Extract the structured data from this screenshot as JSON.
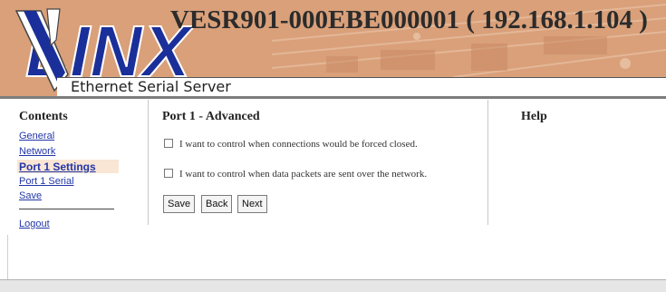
{
  "header": {
    "device_title": "VESR901-000EBE000001 ( 192.168.1.104 )",
    "brand": "VLINX",
    "tagline": "Ethernet Serial Server"
  },
  "sidebar": {
    "title": "Contents",
    "items": [
      {
        "label": "General"
      },
      {
        "label": "Network"
      },
      {
        "label": "Port 1 Settings"
      },
      {
        "label": "Port 1 Serial"
      },
      {
        "label": "Save"
      }
    ],
    "logout": "Logout"
  },
  "main": {
    "title": "Port 1 - Advanced",
    "options": [
      {
        "label": "I want to control when connections would be forced closed.",
        "checked": false
      },
      {
        "label": "I want to control when data packets are sent over the network.",
        "checked": false
      }
    ],
    "buttons": {
      "save": "Save",
      "back": "Back",
      "next": "Next"
    }
  },
  "help": {
    "title": "Help"
  },
  "colors": {
    "header_bg": "#d9a07a",
    "logo_blue": "#1b2f9a",
    "link": "#2236a8",
    "active_item_bg": "#f9e6d4"
  }
}
